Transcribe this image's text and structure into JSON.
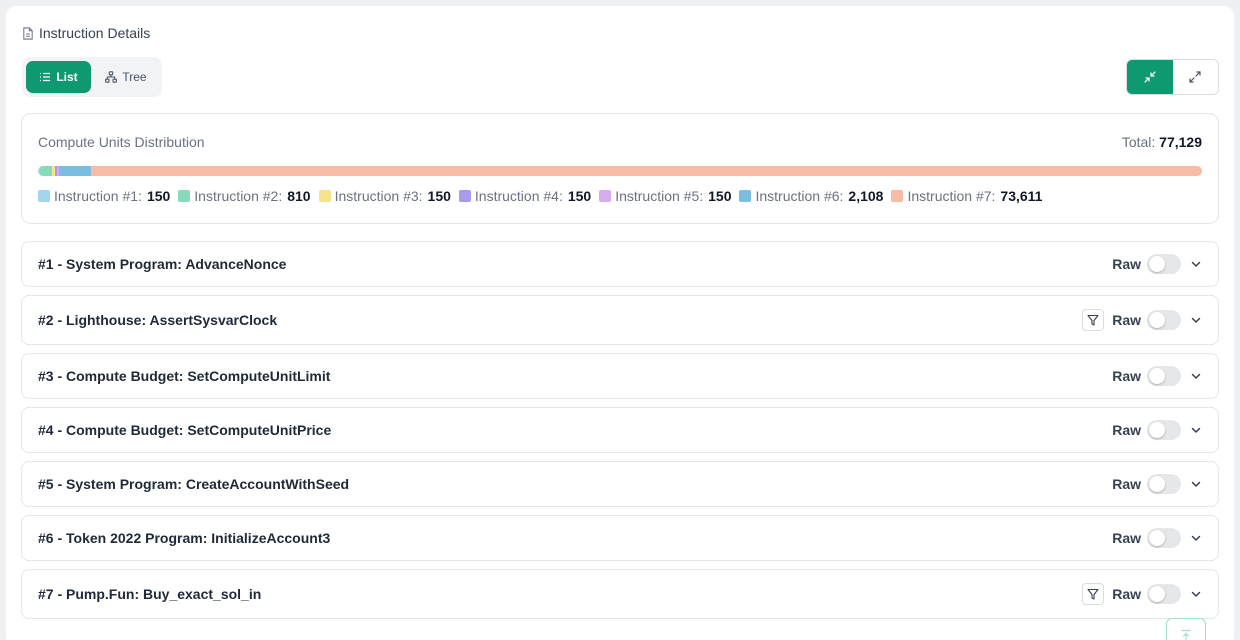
{
  "header": {
    "title": "Instruction Details"
  },
  "view_toggle": {
    "list_label": "List",
    "tree_label": "Tree",
    "active": "list"
  },
  "expand_controls": {
    "active": "collapse"
  },
  "compute_units": {
    "title": "Compute Units Distribution",
    "total_label": "Total:",
    "total_value": "77,129",
    "items": [
      {
        "label": "Instruction #1:",
        "value": "150",
        "units": 150,
        "color": "#a3d4f2"
      },
      {
        "label": "Instruction #2:",
        "value": "810",
        "units": 810,
        "color": "#86dcb8"
      },
      {
        "label": "Instruction #3:",
        "value": "150",
        "units": 150,
        "color": "#f7e38a"
      },
      {
        "label": "Instruction #4:",
        "value": "150",
        "units": 150,
        "color": "#a89cf0"
      },
      {
        "label": "Instruction #5:",
        "value": "150",
        "units": 150,
        "color": "#d8abf0"
      },
      {
        "label": "Instruction #6:",
        "value": "2,108",
        "units": 2108,
        "color": "#79bde0"
      },
      {
        "label": "Instruction #7:",
        "value": "73,611",
        "units": 73611,
        "color": "#f8bca6"
      }
    ]
  },
  "instructions": [
    {
      "label": "#1 - System Program: AdvanceNonce",
      "raw_label": "Raw",
      "raw_on": false,
      "has_filter": false
    },
    {
      "label": "#2 - Lighthouse: AssertSysvarClock",
      "raw_label": "Raw",
      "raw_on": false,
      "has_filter": true
    },
    {
      "label": "#3 - Compute Budget: SetComputeUnitLimit",
      "raw_label": "Raw",
      "raw_on": false,
      "has_filter": false
    },
    {
      "label": "#4 - Compute Budget: SetComputeUnitPrice",
      "raw_label": "Raw",
      "raw_on": false,
      "has_filter": false
    },
    {
      "label": "#5 - System Program: CreateAccountWithSeed",
      "raw_label": "Raw",
      "raw_on": false,
      "has_filter": false
    },
    {
      "label": "#6 - Token 2022 Program: InitializeAccount3",
      "raw_label": "Raw",
      "raw_on": false,
      "has_filter": false
    },
    {
      "label": "#7 - Pump.Fun: Buy_exact_sol_in",
      "raw_label": "Raw",
      "raw_on": false,
      "has_filter": true
    }
  ],
  "icons": {
    "title": "document-icon",
    "list": "list-icon",
    "tree": "tree-icon",
    "collapse": "collapse-icon",
    "expand": "expand-icon",
    "filter": "filter-icon",
    "chevron": "chevron-down-icon",
    "scroll_top": "arrow-up-icon"
  },
  "colors": {
    "accent": "#0e9970"
  }
}
